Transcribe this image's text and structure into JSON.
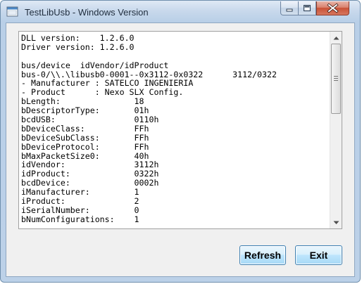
{
  "window": {
    "title": "TestLibUsb - Windows Version"
  },
  "caption_buttons": {
    "minimize": "minimize-icon",
    "maximize": "maximize-icon",
    "close": "close-icon"
  },
  "output": {
    "lines": [
      "DLL version:    1.2.6.0",
      "Driver version: 1.2.6.0",
      "",
      "bus/device  idVendor/idProduct",
      "bus-0/\\\\.\\libusb0-0001--0x3112-0x0322      3112/0322",
      "- Manufacturer : SATELCO INGENIERIA",
      "- Product      : Nexo SLX Config.",
      "bLength:               18",
      "bDescriptorType:       01h",
      "bcdUSB:                0110h",
      "bDeviceClass:          FFh",
      "bDeviceSubClass:       FFh",
      "bDeviceProtocol:       FFh",
      "bMaxPacketSize0:       40h",
      "idVendor:              3112h",
      "idProduct:             0322h",
      "bcdDevice:             0002h",
      "iManufacturer:         1",
      "iProduct:              2",
      "iSerialNumber:         0",
      "bNumConfigurations:    1"
    ]
  },
  "buttons": {
    "refresh": "Refresh",
    "exit": "Exit"
  },
  "colors": {
    "window_frame": "#b9cfe7",
    "close_button": "#c95135",
    "button_border": "#3c7fb1"
  }
}
